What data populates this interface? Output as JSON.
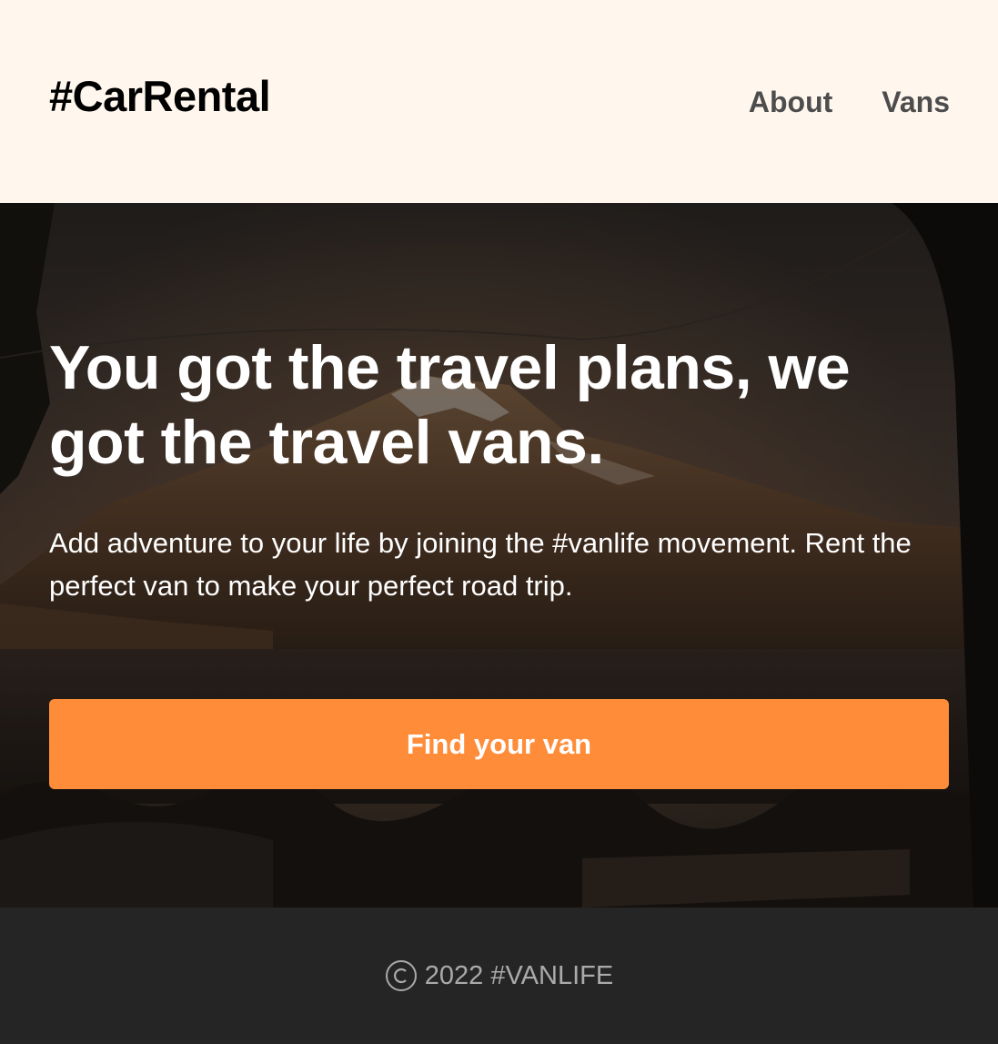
{
  "header": {
    "logo": "#CarRental",
    "nav": [
      {
        "label": "About"
      },
      {
        "label": "Vans"
      }
    ]
  },
  "hero": {
    "title": "You got the travel plans, we got the travel vans.",
    "text": "Add adventure to your life by joining the #vanlife movement. Rent the perfect van to make your perfect road trip.",
    "cta_label": "Find your van",
    "background_icon": "mountain-lake-photo-icon"
  },
  "footer": {
    "copyright_icon": "copyright-icon",
    "text": "2022 #VANLIFE"
  },
  "colors": {
    "header_bg": "#fff7ed",
    "accent": "#ff8c38",
    "footer_bg": "#252525",
    "footer_text": "#aaaaaa"
  }
}
